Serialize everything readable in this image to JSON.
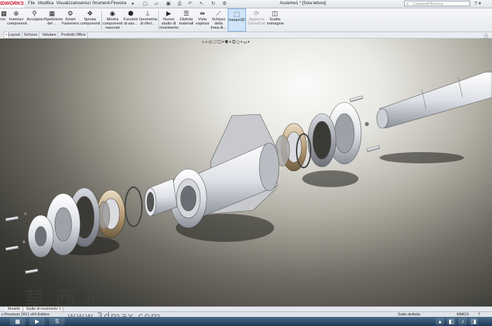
{
  "app": {
    "logo": "SOLIDWORKS",
    "logo_short": "IDWORKS",
    "doc_title": "Assieme1 * [Sola lettura]"
  },
  "menu": [
    "File",
    "Modifica",
    "Visualizza",
    "Inserisci",
    "Strumenti",
    "Finestra"
  ],
  "search": {
    "placeholder": "Comandi Ricerca"
  },
  "ribbon": {
    "buttons": [
      {
        "label": "Inserisci componenti",
        "icon": "insert-component-icon",
        "glyph": "⊕"
      },
      {
        "label": "Accoppia",
        "icon": "mate-icon",
        "glyph": "⚲"
      },
      {
        "label": "Ripetizione del ...",
        "icon": "pattern-icon",
        "glyph": "▦"
      },
      {
        "label": "Smart Fasteners",
        "icon": "fastener-icon",
        "glyph": "⚙"
      },
      {
        "label": "Sposta componenti",
        "icon": "move-component-icon",
        "glyph": "✥"
      },
      {
        "label": "Mostra componenti nascosti",
        "icon": "show-hidden-icon",
        "glyph": "◉"
      },
      {
        "label": "Funzioni di ass...",
        "icon": "assembly-feature-icon",
        "glyph": "⬢"
      },
      {
        "label": "Geometria di riferi...",
        "icon": "reference-geometry-icon",
        "glyph": "⟂"
      },
      {
        "label": "Nuovo studio di movimento",
        "icon": "motion-study-icon",
        "glyph": "▶"
      },
      {
        "label": "Distinta materiali",
        "icon": "bom-icon",
        "glyph": "☰"
      },
      {
        "label": "Vista esplosa",
        "icon": "exploded-view-icon",
        "glyph": "⇹"
      },
      {
        "label": "Schizzo della linea di...",
        "icon": "explode-line-icon",
        "glyph": "⟋"
      },
      {
        "label": "Instant3D",
        "icon": "instant3d-icon",
        "glyph": "⬚"
      },
      {
        "label": "Aggiorna SpeedPak",
        "icon": "speedpak-icon",
        "glyph": "⟳"
      },
      {
        "label": "Scatta immagine",
        "icon": "camera-icon",
        "glyph": "◫"
      }
    ]
  },
  "tabs": [
    "Layout",
    "Schizzo",
    "Valutare",
    "Prodotti Office"
  ],
  "bottom_tabs": [
    "Modello",
    "Studio di movimento 1"
  ],
  "status": {
    "left": "s Premium 2011 x64 Edition",
    "sotto": "Sotto definito",
    "units": "MMGS"
  },
  "watermark": {
    "chars": "草西网",
    "url": "www.3dmax.com"
  }
}
